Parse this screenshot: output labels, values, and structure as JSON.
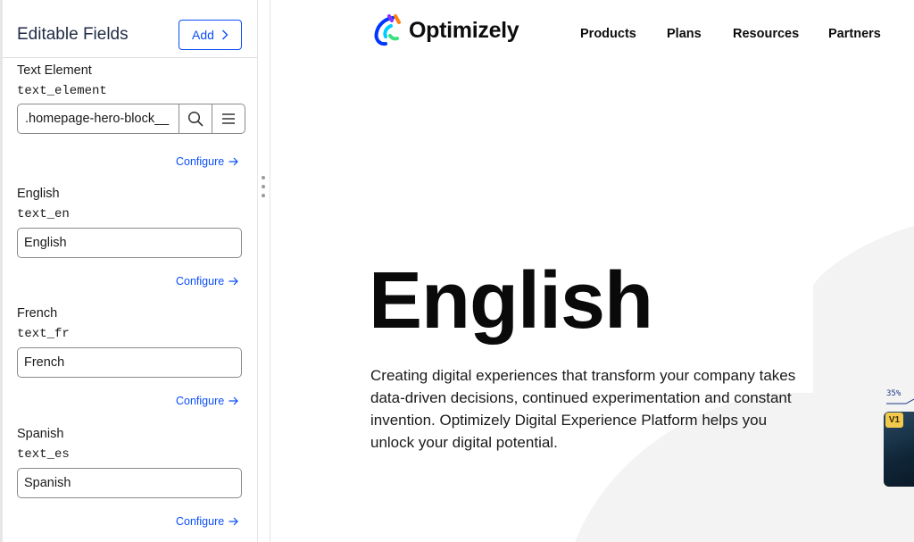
{
  "editor": {
    "title": "Editable Fields",
    "add_label": "Add",
    "fields": [
      {
        "label": "Text Element",
        "key": "text_element",
        "value": ".homepage-hero-block__",
        "configure": "Configure"
      },
      {
        "label": "English",
        "key": "text_en",
        "value": "English",
        "configure": "Configure"
      },
      {
        "label": "French",
        "key": "text_fr",
        "value": "French",
        "configure": "Configure"
      },
      {
        "label": "Spanish",
        "key": "text_es",
        "value": "Spanish",
        "configure": "Configure"
      }
    ]
  },
  "site": {
    "brand": "Optimizely",
    "nav": [
      "Products",
      "Plans",
      "Resources",
      "Partners"
    ],
    "hero_title": "English",
    "hero_body": "Creating digital experiences that transform your company takes data-driven decisions, continued experimentation and constant invention. Optimizely Digital Experience Platform helps you unlock your digital potential.",
    "card_badge": "V1",
    "card_stat": "35%"
  },
  "colors": {
    "accent": "#0b4ff5",
    "badge": "#f2c94c"
  },
  "icons": [
    "chevron-right-icon",
    "search-icon",
    "menu-icon",
    "arrow-right-icon",
    "optimizely-logo-icon"
  ]
}
